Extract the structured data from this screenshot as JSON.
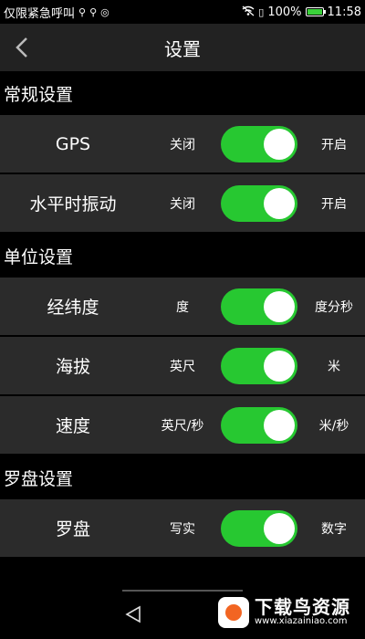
{
  "status_bar": {
    "left_text": "仅限紧急呼叫",
    "battery": "100%",
    "time": "11:58"
  },
  "header": {
    "title": "设置",
    "back_icon": "chevron-left-icon"
  },
  "sections": [
    {
      "title": "常规设置",
      "rows": [
        {
          "label": "GPS",
          "off": "关闭",
          "on": "开启",
          "enabled": true
        },
        {
          "label": "水平时振动",
          "off": "关闭",
          "on": "开启",
          "enabled": true
        }
      ]
    },
    {
      "title": "单位设置",
      "rows": [
        {
          "label": "经纬度",
          "off": "度",
          "on": "度分秒",
          "enabled": true
        },
        {
          "label": "海拔",
          "off": "英尺",
          "on": "米",
          "enabled": true
        },
        {
          "label": "速度",
          "off": "英尺/秒",
          "on": "米/秒",
          "enabled": true
        }
      ]
    },
    {
      "title": "罗盘设置",
      "rows": [
        {
          "label": "罗盘",
          "off": "写实",
          "on": "数字",
          "enabled": true
        }
      ]
    }
  ],
  "watermark": {
    "title": "下载鸟资源",
    "url": "www.xiazainiao.com"
  },
  "colors": {
    "toggle_on": "#27c831",
    "row_bg": "#2b2b2b",
    "header_bg": "#222222"
  }
}
